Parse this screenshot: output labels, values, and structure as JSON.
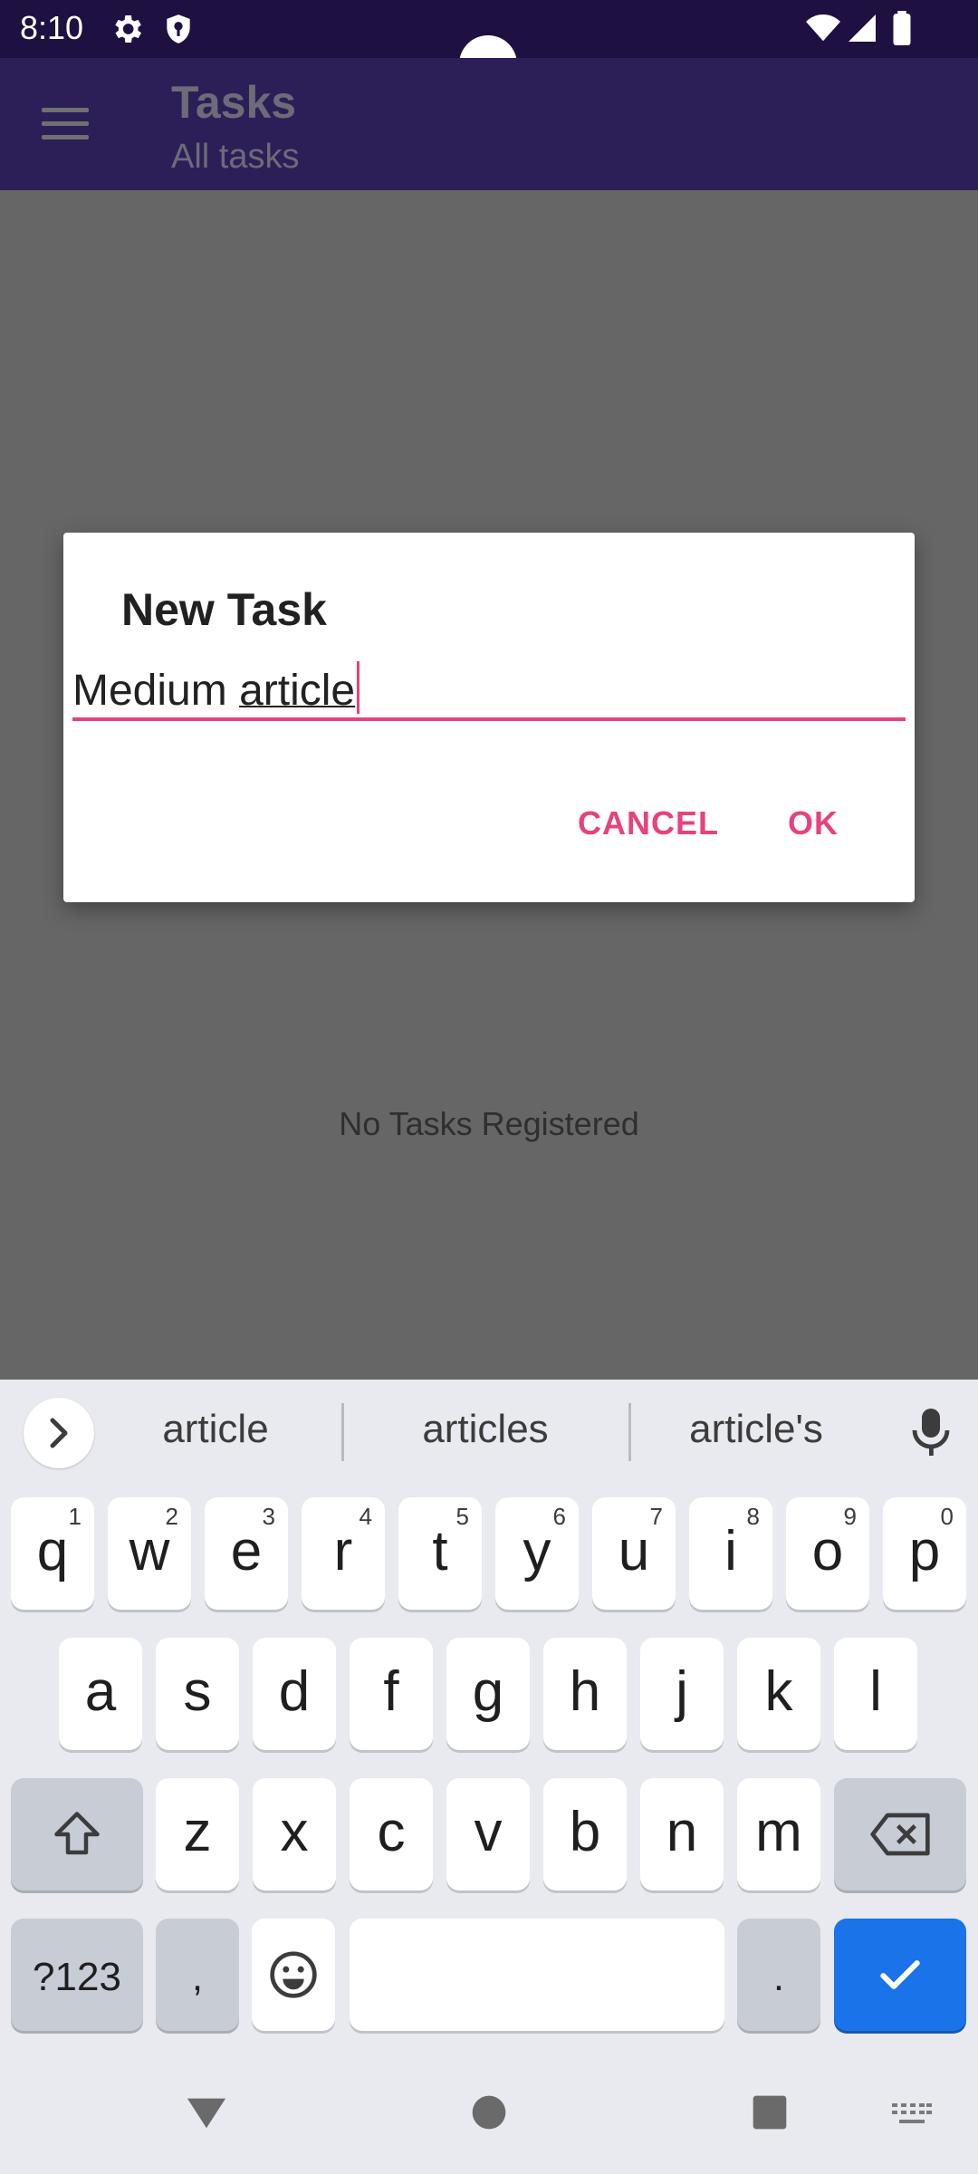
{
  "status_bar": {
    "time": "8:10"
  },
  "app_bar": {
    "title": "Tasks",
    "subtitle": "All tasks"
  },
  "main": {
    "empty_message": "No Tasks Registered"
  },
  "dialog": {
    "title": "New Task",
    "input_value_prefix": "Medium ",
    "input_value_composing": "article",
    "cancel_label": "CANCEL",
    "ok_label": "OK"
  },
  "keyboard": {
    "suggestions": [
      "article",
      "articles",
      "article's"
    ],
    "row1": [
      {
        "k": "q",
        "n": "1"
      },
      {
        "k": "w",
        "n": "2"
      },
      {
        "k": "e",
        "n": "3"
      },
      {
        "k": "r",
        "n": "4"
      },
      {
        "k": "t",
        "n": "5"
      },
      {
        "k": "y",
        "n": "6"
      },
      {
        "k": "u",
        "n": "7"
      },
      {
        "k": "i",
        "n": "8"
      },
      {
        "k": "o",
        "n": "9"
      },
      {
        "k": "p",
        "n": "0"
      }
    ],
    "row2": [
      "a",
      "s",
      "d",
      "f",
      "g",
      "h",
      "j",
      "k",
      "l"
    ],
    "row3": [
      "z",
      "x",
      "c",
      "v",
      "b",
      "n",
      "m"
    ],
    "symbols_label": "?123",
    "comma_label": ",",
    "period_label": "."
  },
  "colors": {
    "accent": "#e8417f",
    "app_bar": "#2c1f58",
    "status_bar": "#1e1040",
    "enter_key": "#1a73e8"
  }
}
